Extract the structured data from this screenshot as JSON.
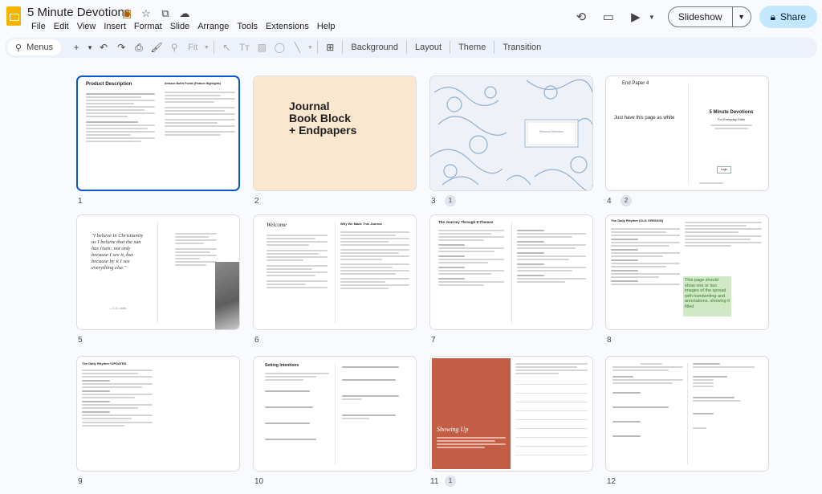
{
  "app": {
    "doc_title": "5 Minute Devotions",
    "menus": [
      "File",
      "Edit",
      "View",
      "Insert",
      "Format",
      "Slide",
      "Arrange",
      "Tools",
      "Extensions",
      "Help"
    ],
    "slideshow_label": "Slideshow",
    "share_label": "Share"
  },
  "toolbar": {
    "menus_search": "Menus",
    "zoom": "Fit",
    "background": "Background",
    "layout": "Layout",
    "theme": "Theme",
    "transition": "Transition"
  },
  "slides": [
    {
      "num": "1",
      "title": "Product Description",
      "right_title": "Amazon Bullet Points (Feature Highlights)"
    },
    {
      "num": "2",
      "title": "Journal\nBook Block\n+ Endpapers",
      "bg": "#fbe6cf"
    },
    {
      "num": "3",
      "comments": "1",
      "label": "Personal Reflection"
    },
    {
      "num": "4",
      "comments": "2",
      "header": "End Paper 4",
      "left_text": "Just have this page as white",
      "book_title": "5 Minute Devotions",
      "book_subtitle": "For Everyday Faith",
      "button": "Login"
    },
    {
      "num": "5",
      "quote": "\"I believe in Christianity as I believe that the sun has risen: not only because I see it, but because by it I see everything else.\"",
      "attrib": "— C.S. Lewis"
    },
    {
      "num": "6",
      "welcome": "Welcome",
      "right_title": "Why We Made This Journal"
    },
    {
      "num": "7",
      "title": "The Journey Through 8 Themes"
    },
    {
      "num": "8",
      "title": "The Daily Rhythm (OLD VERSION)",
      "note": "This page should show one or two images of the spread with handwriting and annotations, showing it filled"
    },
    {
      "num": "9",
      "title": "The Daily Rhythm *UPDATED"
    },
    {
      "num": "10",
      "title": "Setting Intentions"
    },
    {
      "num": "11",
      "comments": "1",
      "script": "Showing Up"
    },
    {
      "num": "12"
    }
  ],
  "colors": {
    "accent": "#0b57d0",
    "share_bg": "#c2e7ff",
    "slide2_bg": "#fbe6cf",
    "slide11_bg": "#c45d45",
    "slide8_note_bg": "#cfe9c4",
    "toile": "#7fa3c9"
  }
}
